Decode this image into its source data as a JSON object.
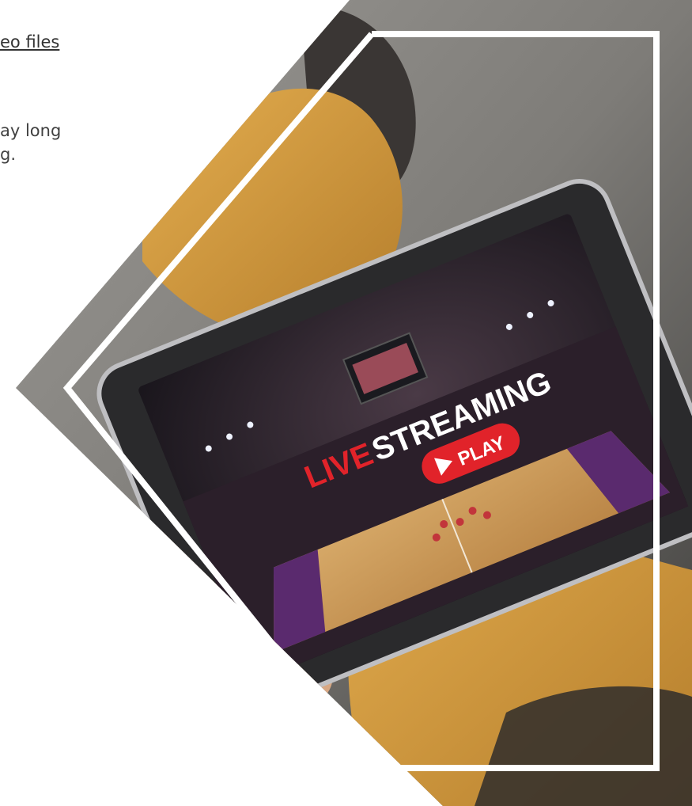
{
  "text": {
    "link_fragment": "eo files",
    "body_line_1": "ay long",
    "body_line_2": "g."
  },
  "screen": {
    "title_live": "LIVE",
    "title_streaming": "STREAMING",
    "play_label": "PLAY"
  },
  "colors": {
    "accent_red": "#e1232a",
    "frame_white": "#ffffff",
    "pants_mustard": "#d39a3c",
    "tablet_bezel": "#2a2a2c",
    "court_wood": "#c99a5b",
    "court_purple": "#5a2a6e"
  }
}
